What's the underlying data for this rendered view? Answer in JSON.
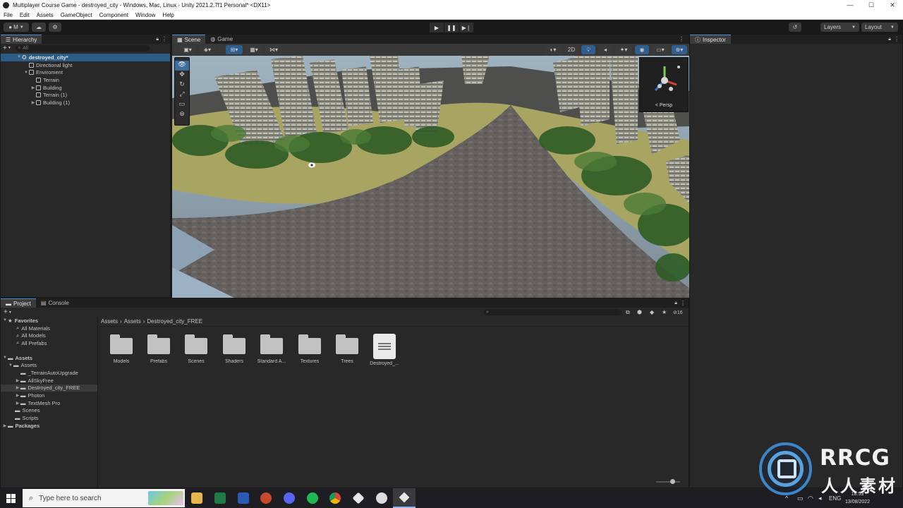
{
  "window": {
    "title": "Multiplayer Course Game - destroyed_city - Windows, Mac, Linux - Unity 2021.2.7f1 Personal* <DX11>",
    "controls": [
      "—",
      "☐",
      "✕"
    ]
  },
  "menu": [
    "File",
    "Edit",
    "Assets",
    "GameObject",
    "Component",
    "Window",
    "Help"
  ],
  "toolbar": {
    "account_label": "M",
    "layers_label": "Layers",
    "layout_label": "Layout"
  },
  "hierarchy": {
    "tab": "Hierarchy",
    "search_placeholder": "All",
    "scene_name": "destroyed_city*",
    "items": [
      {
        "label": "Directional light",
        "depth": 1
      },
      {
        "label": "Enviroment",
        "depth": 1
      },
      {
        "label": "Terrain",
        "depth": 2
      },
      {
        "label": "Building",
        "depth": 2
      },
      {
        "label": "Terrain (1)",
        "depth": 2
      },
      {
        "label": "Building (1)",
        "depth": 2
      }
    ]
  },
  "scene": {
    "tabs": [
      "Scene",
      "Game"
    ],
    "mode_2d": "2D",
    "gizmo_label": "Persp"
  },
  "inspector": {
    "tab": "Inspector"
  },
  "project": {
    "tabs": [
      "Project",
      "Console"
    ],
    "hidden_count": "16",
    "breadcrumb": [
      "Assets",
      "Assets",
      "Destroyed_city_FREE"
    ],
    "favorites_label": "Favorites",
    "favorites": [
      "All Materials",
      "All Models",
      "All Prefabs"
    ],
    "tree": {
      "root": "Assets",
      "sub": "Assets",
      "children": [
        "_TerrainAutoUpgrade",
        "AllSkyFree",
        "Destroyed_city_FREE",
        "Photon",
        "TextMesh Pro"
      ],
      "after": [
        "Scenes",
        "Scripts"
      ],
      "packages": "Packages"
    },
    "assets": [
      "Models",
      "Prefabs",
      "Scenes",
      "Shaders",
      "Standard A...",
      "Textures",
      "Trees",
      "Destroyed_..."
    ]
  },
  "taskbar": {
    "search_placeholder": "Type here to search",
    "lang": "ENG",
    "time": "18:53",
    "date": "13/08/2022"
  },
  "watermark": {
    "brand": "RRCG",
    "chinese": "人人素材"
  },
  "colors": {
    "accent": "#4a90d9",
    "panel": "#282828",
    "sky": "#8fa3b0",
    "ground": "#6d6a66",
    "grass": "#a5a660",
    "foliage": "#2f5e26"
  }
}
